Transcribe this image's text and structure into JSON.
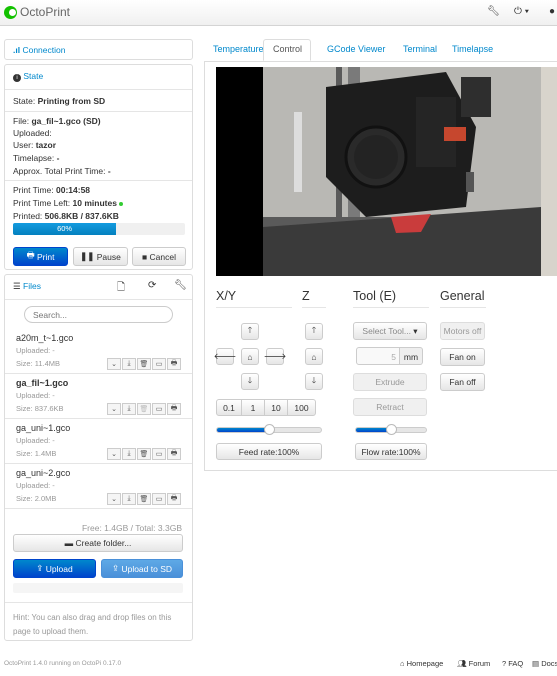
{
  "app": {
    "title": "OctoPrint"
  },
  "sidebar": {
    "connection_label": "Connection",
    "state": {
      "heading": "State",
      "state_label": "State:",
      "state_value": "Printing from SD",
      "file_label": "File:",
      "file_value": "ga_fil~1.gco (SD)",
      "uploaded_label": "Uploaded:",
      "user_label": "User:",
      "user_value": "tazor",
      "timelapse_label": "Timelapse:",
      "timelapse_value": "-",
      "approx_label": "Approx. Total Print Time:",
      "approx_value": "-",
      "print_time_label": "Print Time:",
      "print_time_value": "00:14:58",
      "time_left_label": "Print Time Left:",
      "time_left_value": "10 minutes",
      "printed_label": "Printed:",
      "printed_value": "506.8KB / 837.6KB",
      "progress_text": "60%",
      "progress_fraction": 0.6,
      "print_button": "Print",
      "pause_button": "Pause",
      "cancel_button": "Cancel"
    },
    "files": {
      "heading": "Files",
      "search_placeholder": "Search...",
      "items": [
        {
          "name": "a20m_t~1.gco",
          "uploaded": "Uploaded: -",
          "size": "Size: 11.4MB",
          "selected": false
        },
        {
          "name": "ga_fil~1.gco",
          "uploaded": "Uploaded: -",
          "size": "Size: 837.6KB",
          "selected": true
        },
        {
          "name": "ga_uni~1.gco",
          "uploaded": "Uploaded: -",
          "size": "Size: 1.4MB",
          "selected": false
        },
        {
          "name": "ga_uni~2.gco",
          "uploaded": "Uploaded: -",
          "size": "Size: 2.0MB",
          "selected": false
        }
      ],
      "free_total": "Free: 1.4GB / Total: 3.3GB",
      "create_folder": "Create folder...",
      "upload": "Upload",
      "upload_sd": "Upload to SD",
      "hint": "Hint: You can also drag and drop files on this page to upload them."
    }
  },
  "tabs": [
    "Temperature",
    "Control",
    "GCode Viewer",
    "Terminal",
    "Timelapse"
  ],
  "control": {
    "xy_heading": "X/Y",
    "z_heading": "Z",
    "tool_heading": "Tool (E)",
    "general_heading": "General",
    "step_sizes": [
      "0.1",
      "1",
      "10",
      "100"
    ],
    "feed_rate": "Feed rate:100%",
    "feed_rate_fraction": 0.5,
    "select_tool": "Select Tool...",
    "extrude_amount": "5",
    "extrude_unit": "mm",
    "extrude": "Extrude",
    "retract": "Retract",
    "flow_rate": "Flow rate:100%",
    "flow_rate_fraction": 0.5,
    "motors_off": "Motors off",
    "fan_on": "Fan on",
    "fan_off": "Fan off"
  },
  "footer": {
    "version": "OctoPrint 1.4.0 running on OctoPi 0.17.0",
    "links": [
      "Homepage",
      "Forum",
      "FAQ",
      "Docs"
    ]
  }
}
